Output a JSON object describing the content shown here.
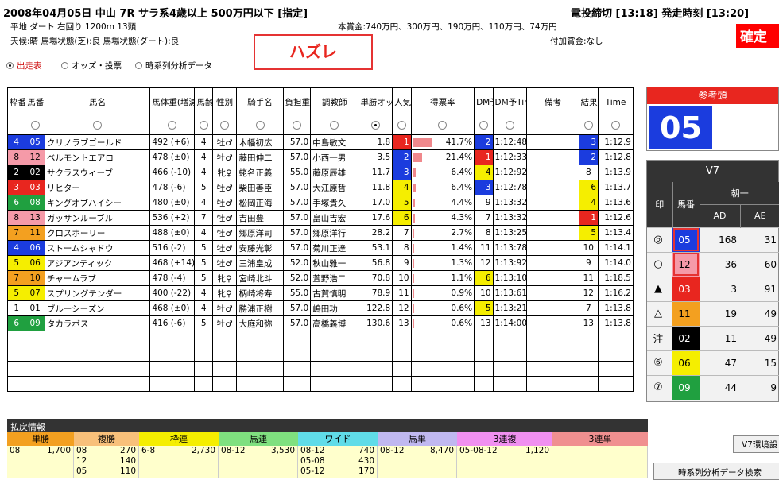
{
  "header": {
    "race_title": "2008年04月05日 中山 7R サラ系4歳以上 500万円以下 [指定]",
    "deadline": "電投締切 [13:18] 発走時刻 [13:20]",
    "course": "平地 ダート 右回り 1200m 13頭",
    "condition": "天候:晴 馬場状態(芝):良 馬場状態(ダート):良",
    "prize": "本賞金:740万円、300万円、190万円、110万円、74万円",
    "extra_prize": "付加賞金:なし",
    "confirm": "確定"
  },
  "tabs": [
    {
      "label": "出走表",
      "selected": true
    },
    {
      "label": "オッズ・投票",
      "selected": false
    },
    {
      "label": "時系列分析データ",
      "selected": false
    }
  ],
  "hazure": "ハズレ",
  "table": {
    "headers": [
      "枠番",
      "馬番",
      "馬名",
      "馬体重(増減)",
      "馬齢",
      "性別",
      "騎手名",
      "負担重量",
      "調教師",
      "単勝オッズ",
      "人気",
      "得票率",
      "DM予",
      "DM予Time",
      "備考",
      "結果",
      "Time"
    ],
    "rows": [
      {
        "waku": "4",
        "uma": "05",
        "name": "クリノラブゴールド",
        "weight": "492 (+6)",
        "age": "4",
        "sex": "牡♂",
        "jockey": "木幡初広",
        "kinryo": "57.0",
        "trainer": "中島敏文",
        "odds": "1.8",
        "ninki": "1",
        "rate": "41.7%",
        "rate_v": 41.7,
        "dm": "2",
        "dmtime": "1:12:48",
        "bikou": "",
        "result": "3",
        "time": "1:12.9"
      },
      {
        "waku": "8",
        "uma": "12",
        "name": "ベルモントエアロ",
        "weight": "478 (±0)",
        "age": "4",
        "sex": "牡♂",
        "jockey": "藤田伸二",
        "kinryo": "57.0",
        "trainer": "小西一男",
        "odds": "3.5",
        "ninki": "2",
        "rate": "21.4%",
        "rate_v": 21.4,
        "dm": "1",
        "dmtime": "1:12:33",
        "bikou": "",
        "result": "2",
        "time": "1:12.8"
      },
      {
        "waku": "2",
        "uma": "02",
        "name": "サクラスウィーブ",
        "weight": "466 (-10)",
        "age": "4",
        "sex": "牝♀",
        "jockey": "蛯名正義",
        "kinryo": "55.0",
        "trainer": "藤原辰雄",
        "odds": "11.7",
        "ninki": "3",
        "rate": "6.4%",
        "rate_v": 6.4,
        "dm": "4",
        "dmtime": "1:12:92",
        "bikou": "",
        "result": "8",
        "time": "1:13.9"
      },
      {
        "waku": "3",
        "uma": "03",
        "name": "リヒター",
        "weight": "478 (-6)",
        "age": "5",
        "sex": "牡♂",
        "jockey": "柴田善臣",
        "kinryo": "57.0",
        "trainer": "大江原哲",
        "odds": "11.8",
        "ninki": "4",
        "rate": "6.4%",
        "rate_v": 6.4,
        "dm": "3",
        "dmtime": "1:12:78",
        "bikou": "",
        "result": "6",
        "time": "1:13.7"
      },
      {
        "waku": "6",
        "uma": "08",
        "name": "キングオブハイシー",
        "weight": "480 (±0)",
        "age": "4",
        "sex": "牡♂",
        "jockey": "松岡正海",
        "kinryo": "57.0",
        "trainer": "手塚貴久",
        "odds": "17.0",
        "ninki": "5",
        "rate": "4.4%",
        "rate_v": 4.4,
        "dm": "9",
        "dmtime": "1:13:32",
        "bikou": "",
        "result": "4",
        "time": "1:13.6"
      },
      {
        "waku": "8",
        "uma": "13",
        "name": "ガッサンルーブル",
        "weight": "536 (+2)",
        "age": "7",
        "sex": "牡♂",
        "jockey": "吉田豊",
        "kinryo": "57.0",
        "trainer": "畠山吉宏",
        "odds": "17.6",
        "ninki": "6",
        "rate": "4.3%",
        "rate_v": 4.3,
        "dm": "7",
        "dmtime": "1:13:32",
        "bikou": "",
        "result": "1",
        "time": "1:12.6"
      },
      {
        "waku": "7",
        "uma": "11",
        "name": "クロスホーリー",
        "weight": "488 (±0)",
        "age": "4",
        "sex": "牡♂",
        "jockey": "郷原洋司",
        "kinryo": "57.0",
        "trainer": "郷原洋行",
        "odds": "28.2",
        "ninki": "7",
        "rate": "2.7%",
        "rate_v": 2.7,
        "dm": "8",
        "dmtime": "1:13:25",
        "bikou": "",
        "result": "5",
        "time": "1:13.4"
      },
      {
        "waku": "4",
        "uma": "06",
        "name": "ストームシャドウ",
        "weight": "516 (-2)",
        "age": "5",
        "sex": "牡♂",
        "jockey": "安藤光彰",
        "kinryo": "57.0",
        "trainer": "菊川正達",
        "odds": "53.1",
        "ninki": "8",
        "rate": "1.4%",
        "rate_v": 1.4,
        "dm": "11",
        "dmtime": "1:13:78",
        "bikou": "",
        "result": "10",
        "time": "1:14.1"
      },
      {
        "waku": "5",
        "uma": "06",
        "name": "アジアンティック",
        "weight": "468 (+14)",
        "age": "5",
        "sex": "牡♂",
        "jockey": "三浦皇成",
        "kinryo": "52.0",
        "trainer": "秋山雅一",
        "odds": "56.8",
        "ninki": "9",
        "rate": "1.3%",
        "rate_v": 1.3,
        "dm": "12",
        "dmtime": "1:13:92",
        "bikou": "",
        "result": "9",
        "time": "1:14.0"
      },
      {
        "waku": "7",
        "uma": "10",
        "name": "チャームラブ",
        "weight": "478 (-4)",
        "age": "5",
        "sex": "牝♀",
        "jockey": "宮崎北斗",
        "kinryo": "52.0",
        "trainer": "萱野浩二",
        "odds": "70.8",
        "ninki": "10",
        "rate": "1.1%",
        "rate_v": 1.1,
        "dm": "6",
        "dmtime": "1:13:10",
        "bikou": "",
        "result": "11",
        "time": "1:18.5"
      },
      {
        "waku": "5",
        "uma": "07",
        "name": "スプリングテンダー",
        "weight": "400 (-22)",
        "age": "4",
        "sex": "牝♀",
        "jockey": "柄崎将寿",
        "kinryo": "55.0",
        "trainer": "古賀慎明",
        "odds": "78.9",
        "ninki": "11",
        "rate": "0.9%",
        "rate_v": 0.9,
        "dm": "10",
        "dmtime": "1:13:61",
        "bikou": "",
        "result": "12",
        "time": "1:16.2"
      },
      {
        "waku": "1",
        "uma": "01",
        "name": "ブルーシーズン",
        "weight": "468 (±0)",
        "age": "4",
        "sex": "牡♂",
        "jockey": "勝浦正樹",
        "kinryo": "57.0",
        "trainer": "嶋田功",
        "odds": "122.8",
        "ninki": "12",
        "rate": "0.6%",
        "rate_v": 0.6,
        "dm": "5",
        "dmtime": "1:13:21",
        "bikou": "",
        "result": "7",
        "time": "1:13.8"
      },
      {
        "waku": "6",
        "uma": "09",
        "name": "タカラボス",
        "weight": "416 (-6)",
        "age": "5",
        "sex": "牡♂",
        "jockey": "大庭和弥",
        "kinryo": "57.0",
        "trainer": "高橋義博",
        "odds": "130.6",
        "ninki": "13",
        "rate": "0.6%",
        "rate_v": 0.6,
        "dm": "13",
        "dmtime": "1:14:00",
        "bikou": "",
        "result": "13",
        "time": "1:13.8"
      }
    ],
    "empty_rows": 4
  },
  "sanko": {
    "title": "参考頭",
    "number": "05"
  },
  "v7": {
    "title": "V7",
    "group": "朝一",
    "col_mark": "印",
    "col_uma": "馬番",
    "col_ad": "AD",
    "col_ae": "AE",
    "rows": [
      {
        "mark": "◎",
        "uma": "05",
        "ad": "168",
        "ae": "31"
      },
      {
        "mark": "○",
        "uma": "12",
        "ad": "36",
        "ae": "60"
      },
      {
        "mark": "▲",
        "uma": "03",
        "ad": "3",
        "ae": "91"
      },
      {
        "mark": "△",
        "uma": "11",
        "ad": "19",
        "ae": "49"
      },
      {
        "mark": "注",
        "uma": "02",
        "ad": "11",
        "ae": "49"
      },
      {
        "mark": "⑥",
        "uma": "06",
        "ad": "47",
        "ae": "15"
      },
      {
        "mark": "⑦",
        "uma": "09",
        "ad": "44",
        "ae": "9"
      }
    ]
  },
  "payout": {
    "title": "払戻情報",
    "cols": [
      {
        "label": "単勝",
        "rows": [
          [
            "08",
            "1,700"
          ]
        ]
      },
      {
        "label": "複勝",
        "rows": [
          [
            "08",
            "270"
          ],
          [
            "12",
            "140"
          ],
          [
            "05",
            "110"
          ]
        ]
      },
      {
        "label": "枠連",
        "rows": [
          [
            "6-8",
            "2,730"
          ]
        ]
      },
      {
        "label": "馬連",
        "rows": [
          [
            "08-12",
            "3,530"
          ]
        ]
      },
      {
        "label": "ワイド",
        "rows": [
          [
            "08-12",
            "740"
          ],
          [
            "05-08",
            "430"
          ],
          [
            "05-12",
            "170"
          ]
        ]
      },
      {
        "label": "馬単",
        "rows": [
          [
            "08-12",
            "8,470"
          ]
        ]
      },
      {
        "label": "3連複",
        "rows": [
          [
            "05-08-12",
            "1,120"
          ]
        ]
      },
      {
        "label": "3連単",
        "rows": []
      }
    ]
  },
  "buttons": {
    "v7": "V7環境設",
    "timeseries": "時系列分析データ検索"
  }
}
